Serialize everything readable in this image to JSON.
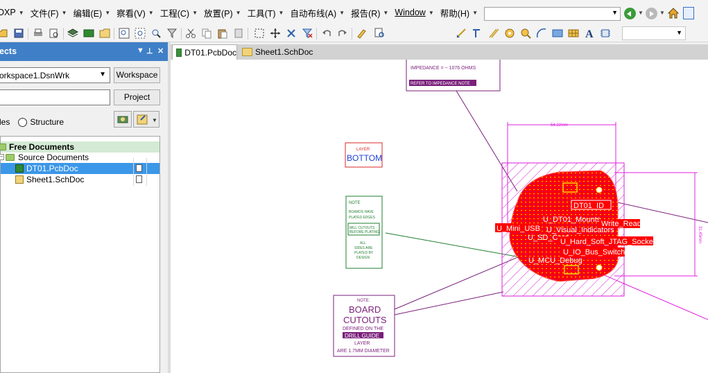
{
  "menubar": {
    "items": [
      "DXP",
      "文件(F)",
      "编辑(E)",
      "察看(V)",
      "工程(C)",
      "放置(P)",
      "工具(T)",
      "自动布线(A)",
      "报告(R)",
      "Window",
      "帮助(H)"
    ]
  },
  "panel": {
    "title": "ects",
    "workspace_value": "orkspace1.DsnWrk",
    "workspace_button": "Workspace",
    "project_button": "Project",
    "radio_files_label": "les",
    "radio_structure_label": "Structure",
    "tree": {
      "group_free": "Free Documents",
      "group_source": "Source Documents",
      "file_pcb": "DT01.PcbDoc",
      "file_sch": "Sheet1.SchDoc"
    }
  },
  "tabs": [
    {
      "label": "DT01.PcbDoc",
      "active": true
    },
    {
      "label": "Sheet1.SchDoc",
      "active": false
    }
  ],
  "canvas": {
    "impedance_text": "IMPEDANCE = ~ 1076 OHMS",
    "impedance_note": "REFER TO IMPEDANCE NOTE",
    "layer_label": "LAYER",
    "bottom_label": "BOTTOM",
    "note_title": "NOTE",
    "note_line1": "BOARDS HAVE",
    "note_line2": "PLATED EDGES",
    "note_box1": "MILL CUTOUTS",
    "note_box2": "BEFORE PLATING",
    "note_line3": "ALL",
    "note_line4": "SIDES ARE",
    "note_line5": "PLATED BY",
    "note_line6": "DESIGN",
    "cutout_note": "NOTE:",
    "cutout_board": "BOARD",
    "cutout_cutouts": "CUTOUTS",
    "cutout_defined": "DEFINED ON THE",
    "cutout_drill": "DRILL GUIDE",
    "cutout_layer": "LAYER",
    "cutout_diameter": "ARE 1.7MM DIAMETER",
    "dimension_top": "54.22mm",
    "dimension_side": "31.45mm",
    "components": [
      "DT01_ID",
      "U_DT01_Mounts",
      "Write_Read",
      "U_Mini_USB",
      "U_Visual_Indicators",
      "U_SD_Card",
      "U_Hard_Soft_JTAG_Socket",
      "U_IO_Bus_Switch",
      "U_MCU_Debug"
    ]
  },
  "colors": {
    "panel_header": "#3f7fc7",
    "pcb_red": "#ff0000",
    "magenta": "#e020e0",
    "note_purple": "#7a1f7a",
    "note_green": "#1f7f2f",
    "selection": "#3b97e8"
  }
}
